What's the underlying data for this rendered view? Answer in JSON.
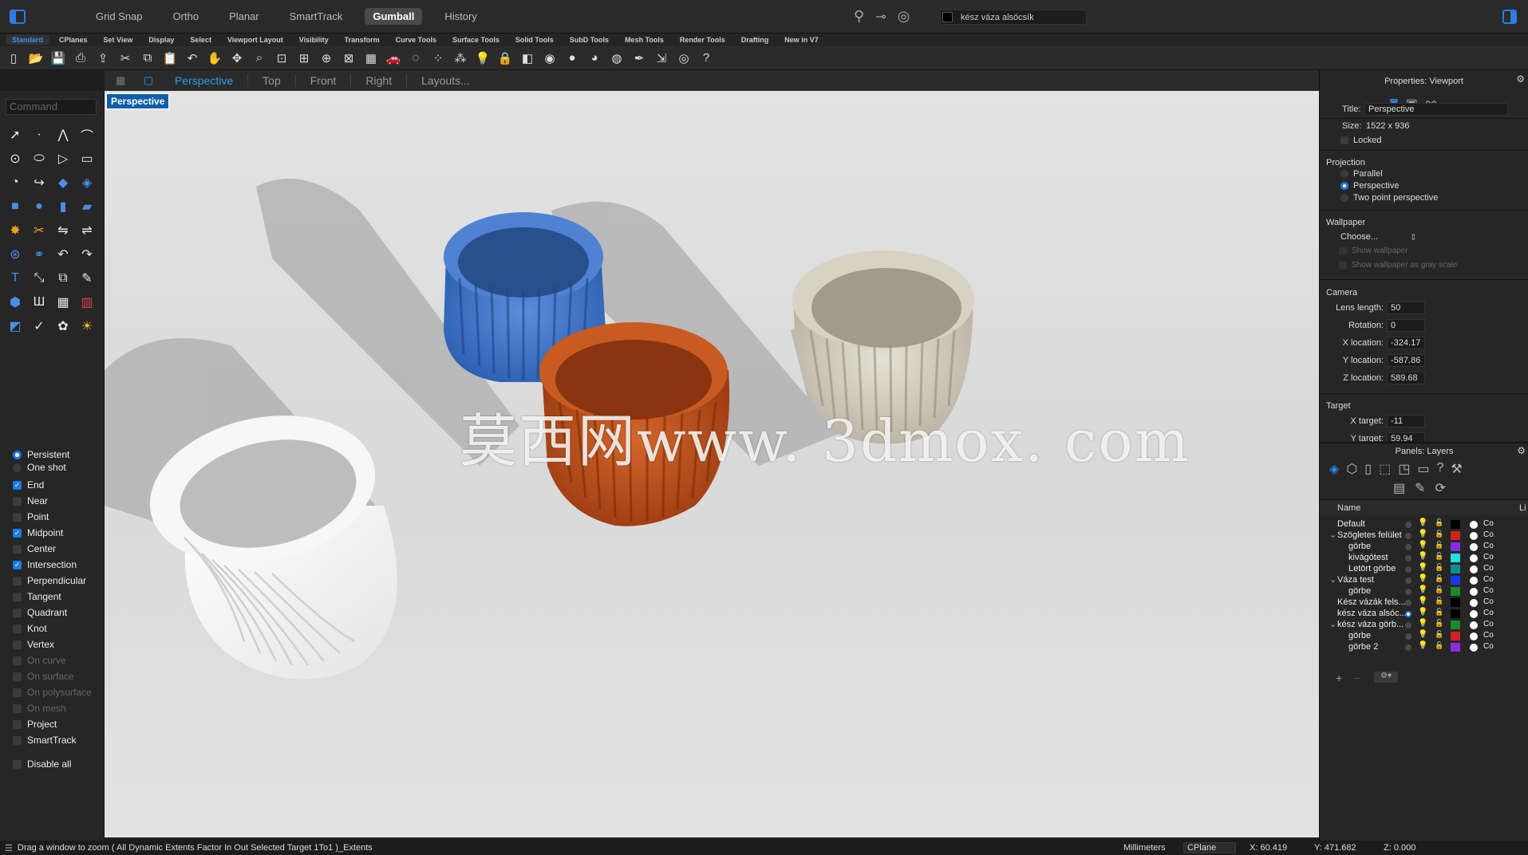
{
  "top": {
    "modes": [
      {
        "label": "Grid Snap",
        "active": false
      },
      {
        "label": "Ortho",
        "active": false
      },
      {
        "label": "Planar",
        "active": false
      },
      {
        "label": "SmartTrack",
        "active": false
      },
      {
        "label": "Gumball",
        "active": true
      },
      {
        "label": "History",
        "active": false
      }
    ],
    "current_layer": "kész váza alsócsík",
    "current_layer_color": "#000000"
  },
  "tabs": [
    "Standard",
    "CPlanes",
    "Set View",
    "Display",
    "Select",
    "Viewport Layout",
    "Visibility",
    "Transform",
    "Curve Tools",
    "Surface Tools",
    "Solid Tools",
    "SubD Tools",
    "Mesh Tools",
    "Render Tools",
    "Drafting",
    "New in V7"
  ],
  "active_tab": "Standard",
  "toolbar_icons": [
    "new-icon",
    "open-icon",
    "save-icon",
    "print-icon",
    "import-icon",
    "cut-icon",
    "copy-icon",
    "paste-icon",
    "undo-icon",
    "pan-icon",
    "rotate-view-icon",
    "zoom-icon",
    "zoom-window-icon",
    "zoom-extents-icon",
    "zoom-selected-icon",
    "zoom-all-icon",
    "viewport-layout-icon",
    "car-icon",
    "hide-icon",
    "show-icon",
    "points-on-icon",
    "light-icon",
    "lock-icon",
    "shading-icon",
    "color-wheel-icon",
    "sphere-icon",
    "render-sphere-icon",
    "material-sphere-icon",
    "pipette-icon",
    "dimension-icon",
    "globe-icon",
    "help-icon"
  ],
  "view_tabs": [
    {
      "label": "Perspective",
      "active": true
    },
    {
      "label": "Top",
      "active": false
    },
    {
      "label": "Front",
      "active": false
    },
    {
      "label": "Right",
      "active": false
    },
    {
      "label": "Layouts...",
      "active": false
    }
  ],
  "command_placeholder": "Command",
  "viewport": {
    "label": "Perspective",
    "watermark": "莫西网www. 3dmox. com"
  },
  "osnap": {
    "modes": [
      {
        "label": "Persistent",
        "on": true
      },
      {
        "label": "One shot",
        "on": false
      }
    ],
    "items": [
      {
        "label": "End",
        "on": true,
        "enabled": true
      },
      {
        "label": "Near",
        "on": false,
        "enabled": true
      },
      {
        "label": "Point",
        "on": false,
        "enabled": true
      },
      {
        "label": "Midpoint",
        "on": true,
        "enabled": true
      },
      {
        "label": "Center",
        "on": false,
        "enabled": true
      },
      {
        "label": "Intersection",
        "on": true,
        "enabled": true
      },
      {
        "label": "Perpendicular",
        "on": false,
        "enabled": true
      },
      {
        "label": "Tangent",
        "on": false,
        "enabled": true
      },
      {
        "label": "Quadrant",
        "on": false,
        "enabled": true
      },
      {
        "label": "Knot",
        "on": false,
        "enabled": true
      },
      {
        "label": "Vertex",
        "on": false,
        "enabled": true
      },
      {
        "label": "On curve",
        "on": false,
        "enabled": false
      },
      {
        "label": "On surface",
        "on": false,
        "enabled": false
      },
      {
        "label": "On polysurface",
        "on": false,
        "enabled": false
      },
      {
        "label": "On mesh",
        "on": false,
        "enabled": false
      },
      {
        "label": "Project",
        "on": false,
        "enabled": true
      },
      {
        "label": "SmartTrack",
        "on": false,
        "enabled": true
      }
    ],
    "disable_all": "Disable all"
  },
  "properties": {
    "panel_title": "Properties: Viewport",
    "title_label": "Title:",
    "title_value": "Perspective",
    "size_label": "Size:",
    "size_value": "1522 x 936",
    "locked_label": "Locked",
    "projection_label": "Projection",
    "projections": [
      {
        "label": "Parallel",
        "on": false
      },
      {
        "label": "Perspective",
        "on": true
      },
      {
        "label": "Two point perspective",
        "on": false
      }
    ],
    "wallpaper_label": "Wallpaper",
    "wallpaper_choose": "Choose...",
    "show_wallpaper": "Show wallpaper",
    "show_wallpaper_gray": "Show wallpaper as gray scale",
    "camera_label": "Camera",
    "camera": [
      {
        "label": "Lens length:",
        "value": "50"
      },
      {
        "label": "Rotation:",
        "value": "0"
      },
      {
        "label": "X location:",
        "value": "-324.17"
      },
      {
        "label": "Y location:",
        "value": "-587.86"
      },
      {
        "label": "Z location:",
        "value": "589.68"
      }
    ],
    "target_label": "Target",
    "target": [
      {
        "label": "X target:",
        "value": "-11"
      },
      {
        "label": "Y target:",
        "value": "59.94"
      }
    ]
  },
  "layers": {
    "panel_title": "Panels: Layers",
    "col_name": "Name",
    "col_li": "Li",
    "rows": [
      {
        "name": "Default",
        "indent": 0,
        "expand": "",
        "color": "#000000",
        "current": false,
        "cut": "Co"
      },
      {
        "name": "Szögletes felület",
        "indent": 0,
        "expand": "v",
        "color": "#d42020",
        "current": false,
        "cut": "Co"
      },
      {
        "name": "görbe",
        "indent": 1,
        "expand": "",
        "color": "#8a2be2",
        "current": false,
        "cut": "Co"
      },
      {
        "name": "kivágótest",
        "indent": 1,
        "expand": "",
        "color": "#20e0e0",
        "current": false,
        "cut": "Co"
      },
      {
        "name": "Letört görbe",
        "indent": 1,
        "expand": "",
        "color": "#0f8f8f",
        "current": false,
        "cut": "Co"
      },
      {
        "name": "Váza test",
        "indent": 0,
        "expand": "v",
        "color": "#1a3ae8",
        "current": false,
        "cut": "Co"
      },
      {
        "name": "görbe",
        "indent": 1,
        "expand": "",
        "color": "#1a8a2a",
        "current": false,
        "cut": "Co"
      },
      {
        "name": "Kész vázák fels...",
        "indent": 0,
        "expand": "",
        "color": "#000000",
        "current": false,
        "cut": "Co"
      },
      {
        "name": "kész váza alsóc...",
        "indent": 0,
        "expand": "",
        "color": "#000000",
        "current": true,
        "cut": "Co"
      },
      {
        "name": "kész váza görb...",
        "indent": 0,
        "expand": "v",
        "color": "#1a8a2a",
        "current": false,
        "cut": "Co"
      },
      {
        "name": "görbe",
        "indent": 1,
        "expand": "",
        "color": "#d42020",
        "current": false,
        "cut": "Co"
      },
      {
        "name": "görbe 2",
        "indent": 1,
        "expand": "",
        "color": "#8a2be2",
        "current": false,
        "cut": "Co"
      }
    ]
  },
  "status": {
    "message": "Drag a window to zoom ( All Dynamic Extents Factor In Out Selected Target 1To1 )_Extents",
    "units": "Millimeters",
    "cplane": "CPlane",
    "x": "X: 60.419",
    "y": "Y: 471.682",
    "z": "Z: 0.000"
  }
}
